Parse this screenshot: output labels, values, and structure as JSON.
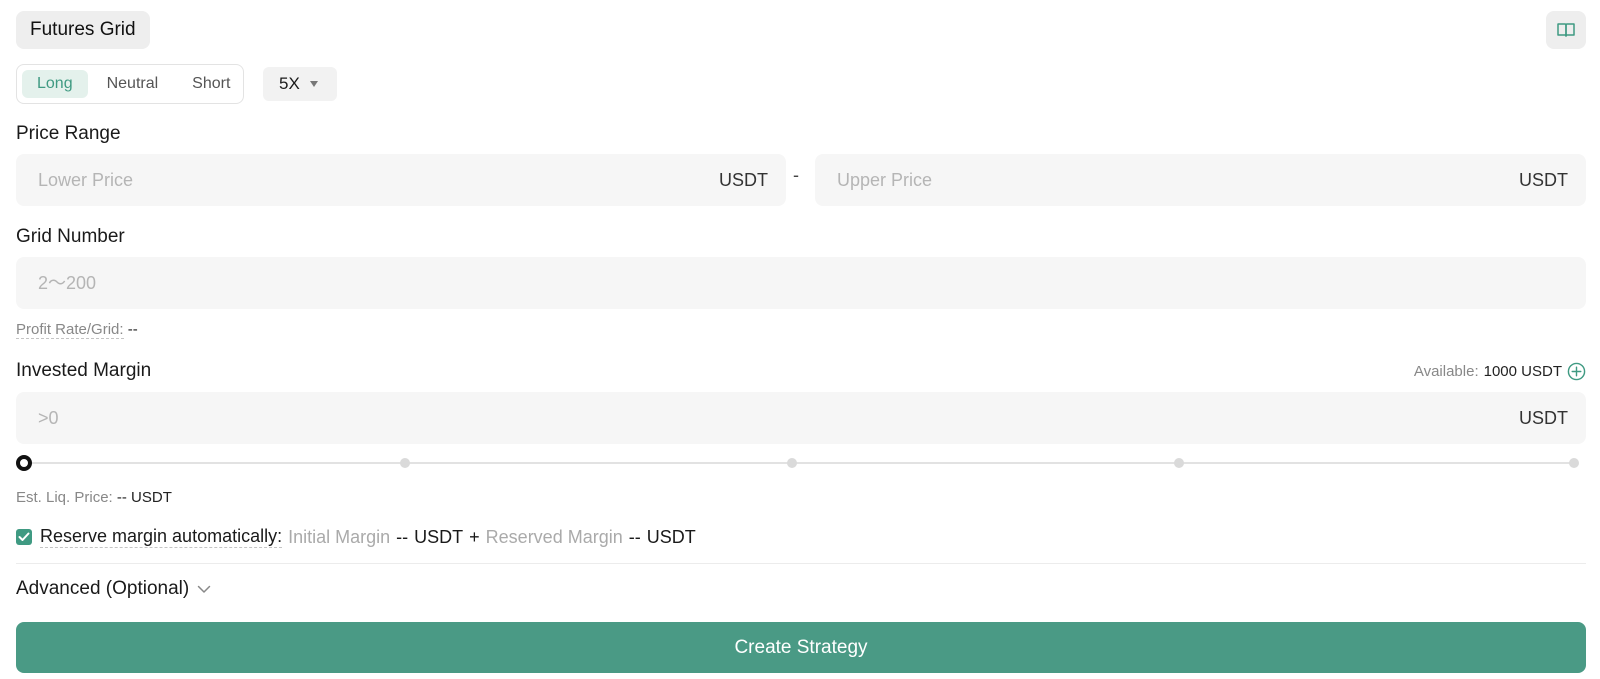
{
  "header": {
    "title": "Futures Grid",
    "guide_icon": "book-icon"
  },
  "direction": {
    "tabs": [
      {
        "label": "Long",
        "active": true
      },
      {
        "label": "Neutral",
        "active": false
      },
      {
        "label": "Short",
        "active": false
      }
    ]
  },
  "leverage": {
    "value": "5X",
    "icon": "caret-down-icon"
  },
  "price_range": {
    "label": "Price Range",
    "lower": {
      "placeholder": "Lower Price",
      "unit": "USDT",
      "value": ""
    },
    "separator": "-",
    "upper": {
      "placeholder": "Upper Price",
      "unit": "USDT",
      "value": ""
    }
  },
  "grid_number": {
    "label": "Grid Number",
    "placeholder": "2～200",
    "value": "",
    "profit_label": "Profit Rate/Grid:",
    "profit_value": "--"
  },
  "invested_margin": {
    "label": "Invested Margin",
    "available_label": "Available:",
    "available_value": "1000 USDT",
    "add_icon": "plus-circle-icon",
    "placeholder": ">0",
    "unit": "USDT",
    "value": "",
    "slider_percent": 0,
    "slider_marks": [
      0,
      25,
      50,
      75,
      100
    ]
  },
  "liquidation": {
    "label": "Est. Liq. Price:",
    "value": "--",
    "unit": "USDT"
  },
  "reserve_margin": {
    "checked": true,
    "label": "Reserve margin automatically:",
    "initial_label": "Initial Margin",
    "initial_value": "--",
    "initial_unit": "USDT",
    "plus": "+",
    "reserved_label": "Reserved Margin",
    "reserved_value": "--",
    "reserved_unit": "USDT"
  },
  "advanced": {
    "label": "Advanced (Optional)",
    "icon": "chevron-down-icon"
  },
  "actions": {
    "create_label": "Create Strategy"
  },
  "colors": {
    "accent": "#4a9a85",
    "accent_soft": "#e4f1ec",
    "field_bg": "#f6f6f6"
  }
}
